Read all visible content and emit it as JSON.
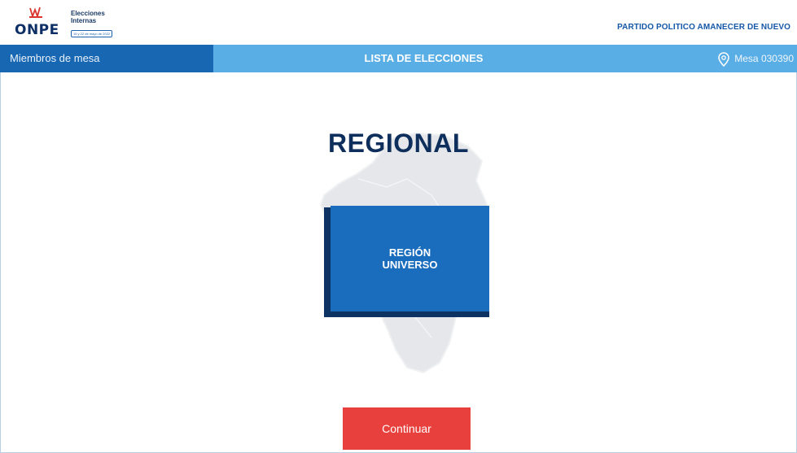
{
  "header": {
    "logo_text": "ONPE",
    "logo_title_line1": "Elecciones",
    "logo_title_line2": "Internas",
    "logo_date": "15 y 22 de mayo de 2022",
    "party_name": "PARTIDO POLITICO AMANECER DE NUEVO"
  },
  "navbar": {
    "left_label": "Miembros de mesa",
    "title": "LISTA DE ELECCIONES",
    "mesa_label": "Mesa 030390"
  },
  "main": {
    "heading": "REGIONAL",
    "card": {
      "line1": "REGIÓN",
      "line2": "UNIVERSO"
    },
    "continue_label": "Continuar"
  },
  "colors": {
    "nav_dark": "#1767b2",
    "nav_light": "#5aaee6",
    "heading": "#0e2e5c",
    "card": "#1a6dbd",
    "card_shadow": "#0d3363",
    "button": "#e8403c"
  },
  "icons": [
    "location-pin-icon",
    "onpe-logo-mark",
    "peru-map-illustration"
  ]
}
